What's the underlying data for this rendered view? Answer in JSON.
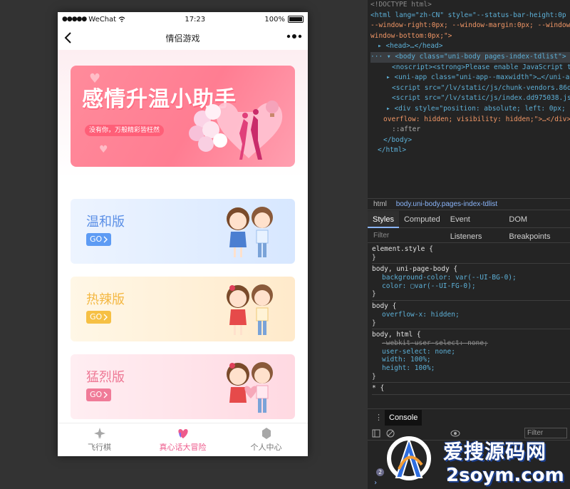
{
  "phone": {
    "status": {
      "signal": "●●●●●",
      "carrier": "WeChat",
      "time": "17:23",
      "battery": "100%"
    },
    "nav": {
      "title": "情侣游戏",
      "back_icon": "‹",
      "more_icon": "•••"
    },
    "banner": {
      "title": "感情升温小助手",
      "subtitle": "没有你，万般精彩皆枉然"
    },
    "cards": [
      {
        "title": "温和版",
        "go": "GO",
        "color": "#5b8fe6"
      },
      {
        "title": "热辣版",
        "go": "GO",
        "color": "#f4b843"
      },
      {
        "title": "猛烈版",
        "go": "GO",
        "color": "#ee7895"
      }
    ],
    "tabbar": [
      {
        "label": "飞行棋",
        "icon": "plane-icon",
        "active": false
      },
      {
        "label": "真心话大冒险",
        "icon": "heart-icon",
        "active": true
      },
      {
        "label": "个人中心",
        "icon": "user-icon",
        "active": false
      }
    ]
  },
  "devtools": {
    "dom": [
      "<!DOCTYPE html>",
      "<html lang=\"zh-CN\" style=\"--status-bar-height:0p",
      "--window-right:0px; --window-margin:0px; --window-",
      "window-bottom:0px;\">",
      "▸ <head>…</head>",
      "··· ▾ <body class=\"uni-body pages-index-tdlist\"> == $",
      "<noscript><strong>Please enable JavaScript t",
      "▸ <uni-app class=\"uni-app--maxwidth\">…</uni-app",
      "<script src=\"/lv/static/js/chunk-vendors.86d",
      "<script src=\"/lv/static/js/index.dd975038.js",
      "▸ <div style=\"position: absolute; left: 0px; to",
      "overflow: hidden; visibility: hidden;\">…</div>",
      "::after",
      "</body>",
      "</html>"
    ],
    "crumbs": [
      "html",
      "body.uni-body.pages-index-tdlist"
    ],
    "tabs": [
      "Styles",
      "Computed",
      "Event Listeners",
      "DOM Breakpoints"
    ],
    "filter_placeholder": "Filter",
    "styles": [
      {
        "selector": "element.style {",
        "props": []
      },
      {
        "selector": "body, uni-page-body {",
        "props": [
          "background-color: var(--UI-BG-0);",
          "color: ▢var(--UI-FG-0);"
        ]
      },
      {
        "selector": "body {",
        "props": [
          "overflow-x: hidden;"
        ]
      },
      {
        "selector": "body, html {",
        "props": [
          "-webkit-user-select: none;",
          "user-select: none;",
          "width: 100%;",
          "height: 100%;"
        ]
      },
      {
        "selector": "* {",
        "props": []
      }
    ],
    "console_label": "Console",
    "console_filter": "Filter",
    "console_count": "2"
  },
  "watermark": {
    "line1": "爱搜源码网",
    "line2": "2soym.com"
  }
}
